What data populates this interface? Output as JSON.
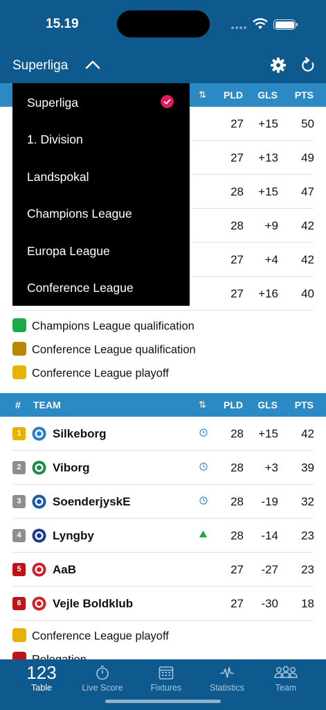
{
  "status": {
    "time": "15.19"
  },
  "nav": {
    "title": "Superliga"
  },
  "columns": {
    "num": "#",
    "team": "TEAM",
    "form": "⇅",
    "pld": "PLD",
    "gls": "GLS",
    "pts": "PTS"
  },
  "top_table": [
    {
      "pld": "27",
      "gls": "+15",
      "pts": "50"
    },
    {
      "pld": "27",
      "gls": "+13",
      "pts": "49"
    },
    {
      "pld": "28",
      "gls": "+15",
      "pts": "47"
    },
    {
      "pld": "28",
      "gls": "+9",
      "pts": "42"
    },
    {
      "pld": "27",
      "gls": "+4",
      "pts": "42"
    },
    {
      "pld": "27",
      "gls": "+16",
      "pts": "40"
    }
  ],
  "legend_top": [
    {
      "label": "Champions League qualification",
      "color": "#1da84a"
    },
    {
      "label": "Conference League qualification",
      "color": "#b98700"
    },
    {
      "label": "Conference League playoff",
      "color": "#e6b400"
    }
  ],
  "bottom_table": [
    {
      "pos": "1",
      "pos_color": "#e6b400",
      "team": "Silkeborg",
      "form": "clock",
      "pld": "28",
      "gls": "+15",
      "pts": "42",
      "crest": "#2a7ec6"
    },
    {
      "pos": "2",
      "pos_color": "#8e8e8e",
      "team": "Viborg",
      "form": "clock",
      "pld": "28",
      "gls": "+3",
      "pts": "39",
      "crest": "#1f8a4c"
    },
    {
      "pos": "3",
      "pos_color": "#8e8e8e",
      "team": "SoenderjyskE",
      "form": "clock",
      "pld": "28",
      "gls": "-19",
      "pts": "32",
      "crest": "#1a5aa8"
    },
    {
      "pos": "4",
      "pos_color": "#8e8e8e",
      "team": "Lyngby",
      "form": "up",
      "pld": "28",
      "gls": "-14",
      "pts": "23",
      "crest": "#1b3e8a"
    },
    {
      "pos": "5",
      "pos_color": "#c1121a",
      "team": "AaB",
      "form": "",
      "pld": "27",
      "gls": "-27",
      "pts": "23",
      "crest": "#d0202a"
    },
    {
      "pos": "6",
      "pos_color": "#c1121a",
      "team": "Vejle Boldklub",
      "form": "",
      "pld": "27",
      "gls": "-30",
      "pts": "18",
      "crest": "#d0202a"
    }
  ],
  "legend_bottom": [
    {
      "label": "Conference League playoff",
      "color": "#e6b400"
    },
    {
      "label": "Relegation",
      "color": "#c1121a"
    }
  ],
  "dropdown": {
    "selected": "Superliga",
    "items": [
      "Superliga",
      "1. Division",
      "Landspokal",
      "Champions League",
      "Europa League",
      "Conference League"
    ]
  },
  "tabs": [
    {
      "label": "Table",
      "icon": "123",
      "active": true
    },
    {
      "label": "Live Score",
      "icon": "stopwatch-icon"
    },
    {
      "label": "Fixtures",
      "icon": "calendar-icon"
    },
    {
      "label": "Statistics",
      "icon": "pulse-icon"
    },
    {
      "label": "Team",
      "icon": "people-icon"
    }
  ]
}
